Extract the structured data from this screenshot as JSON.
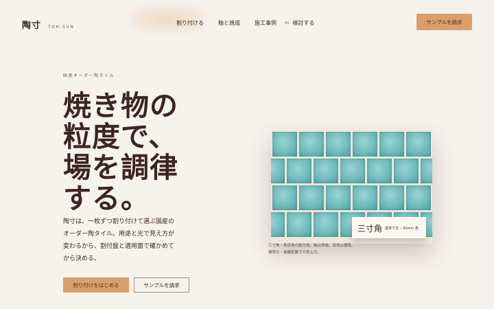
{
  "brand": {
    "name": "陶寸",
    "roman": "TOH-SUN"
  },
  "nav": {
    "items": [
      {
        "label": "割り付ける"
      },
      {
        "label": "釉と焼成"
      },
      {
        "label": "施工事例"
      },
      {
        "num": "04",
        "label": "検討する"
      }
    ],
    "cta": "サンプルを請求"
  },
  "hero": {
    "eyebrow": "国産オーダー陶タイル",
    "title_lines": [
      "焼き物の",
      "粒度で、",
      "場を調律",
      "する。"
    ],
    "lead_lines": [
      "陶寸は、一枚ずつ割り付けて選ぶ国産の",
      "オーダー陶タイル。用途と光で見え方が",
      "変わるから、割付盤と適用面で確かめて",
      "から決める。"
    ],
    "primary_button": "割り付けをはじめる",
    "secondary_button": "サンプルを請求"
  },
  "preview": {
    "tile_color": "#6fbbbb",
    "spec_name": "三寸角",
    "spec_size": "基準寸法 ─ 90mm 角",
    "caption_lines": [
      "三寸角・馬目地の割付例。釉は青磁、目地は標準。",
      "標準光・長観距離での見え方。"
    ]
  }
}
